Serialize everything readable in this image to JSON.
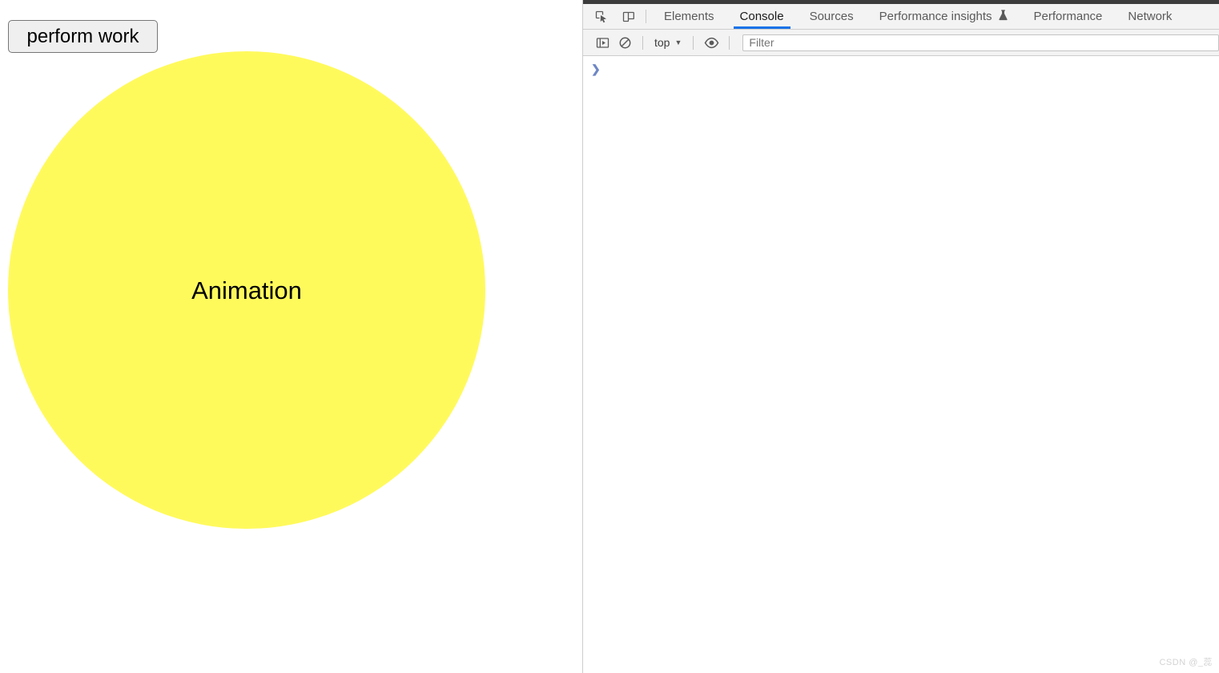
{
  "page": {
    "button_label": "perform work",
    "circle_label": "Animation",
    "circle_color": "#fffa5c",
    "button_bg": "#efefef",
    "button_border": "#767676"
  },
  "devtools": {
    "top_icons": [
      {
        "name": "inspect-element-icon",
        "title": "Inspect element"
      },
      {
        "name": "device-toolbar-icon",
        "title": "Toggle device toolbar"
      }
    ],
    "tabs": [
      {
        "label": "Elements",
        "active": false,
        "badge": ""
      },
      {
        "label": "Console",
        "active": true,
        "badge": ""
      },
      {
        "label": "Sources",
        "active": false,
        "badge": ""
      },
      {
        "label": "Performance insights",
        "active": false,
        "badge": "⚗"
      },
      {
        "label": "Performance",
        "active": false,
        "badge": ""
      },
      {
        "label": "Network",
        "active": false,
        "badge": ""
      }
    ],
    "active_tab_color": "#1a73e8",
    "console_toolbar": {
      "sidebar_toggle": "console-sidebar-icon",
      "clear_console": "clear-console-icon",
      "context_selector": "top",
      "context_caret": "▼",
      "live_expression": "eye-icon",
      "filter_placeholder": "Filter",
      "filter_value": ""
    },
    "console": {
      "prompt_symbol": "❯",
      "input_value": "",
      "messages": []
    }
  },
  "watermark": {
    "text": "CSDN @_蕊"
  }
}
